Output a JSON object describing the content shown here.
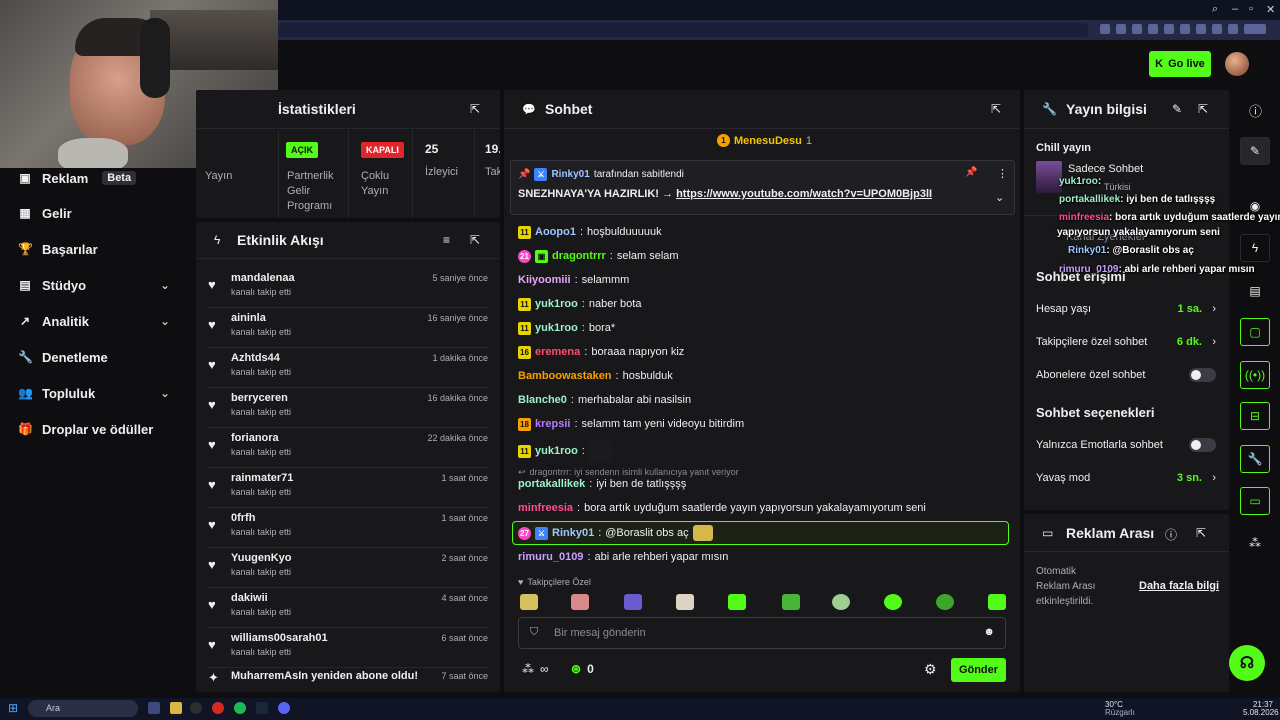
{
  "sidebar": {
    "items": [
      {
        "label": "Reklam",
        "badge": "Beta"
      },
      {
        "label": "Gelir"
      },
      {
        "label": "Başarılar"
      },
      {
        "label": "Stüdyo"
      },
      {
        "label": "Analitik"
      },
      {
        "label": "Denetleme"
      },
      {
        "label": "Topluluk"
      },
      {
        "label": "Droplar ve ödüller"
      }
    ]
  },
  "header": {
    "go_live": "Go live"
  },
  "stats": {
    "title": "İstatistikleri",
    "col1": "Yayın",
    "partner_tag": "AÇIK",
    "partner_label": "Partnerlik Gelir Programı",
    "multi_tag": "KAPALI",
    "multi_label": "Çoklu Yayın",
    "viewers_value": "25",
    "viewers_label": "İzleyici",
    "extra_value": "19.",
    "extra_label": "Tak"
  },
  "activity": {
    "title": "Etkinlik Akışı",
    "events": [
      {
        "name": "mandalenaa",
        "sub": "kanalı takip etti",
        "time": "5 saniye önce"
      },
      {
        "name": "aininla",
        "sub": "kanalı takip etti",
        "time": "16 saniye önce"
      },
      {
        "name": "Azhtds44",
        "sub": "kanalı takip etti",
        "time": "1 dakika önce"
      },
      {
        "name": "berryceren",
        "sub": "kanalı takip etti",
        "time": "16 dakika önce"
      },
      {
        "name": "forianora",
        "sub": "kanalı takip etti",
        "time": "22 dakika önce"
      },
      {
        "name": "rainmater71",
        "sub": "kanalı takip etti",
        "time": "1 saat önce"
      },
      {
        "name": "0frfh",
        "sub": "kanalı takip etti",
        "time": "1 saat önce"
      },
      {
        "name": "YuugenKyo",
        "sub": "kanalı takip etti",
        "time": "2 saat önce"
      },
      {
        "name": "dakiwii",
        "sub": "kanalı takip etti",
        "time": "4 saat önce"
      },
      {
        "name": "williams00sarah01",
        "sub": "kanalı takip etti",
        "time": "6 saat önce"
      }
    ],
    "last": {
      "text": "MuharremAsIn yeniden abone oldu!",
      "time": "7 saat önce"
    }
  },
  "chat": {
    "title": "Sohbet",
    "top_gifter": "MenesuDesu",
    "top_gifter_count": "1",
    "pinned_by": "Rinky01",
    "pinned_by_suffix": "tarafından sabitlendi",
    "pinned_text": "SNEZHNAYA'YA HAZIRLIK! →",
    "pinned_link": "https://www.youtube.com/watch?v=UPOM0Bjp3lI",
    "messages": [
      {
        "badge": "11",
        "badge_type": "y",
        "user": "Aoopo1",
        "color": "#9ec6ff",
        "text": "hoşbulduuuuuk"
      },
      {
        "badge": "21",
        "badge_type": "p",
        "user": "dragontrrr",
        "color": "#53fc18",
        "text": "selam selam"
      },
      {
        "badge": "",
        "badge_type": "",
        "user": "Kiiyoomiii",
        "color": "#e6a7ff",
        "text": "selammm"
      },
      {
        "badge": "11",
        "badge_type": "y",
        "user": "yuk1roo",
        "color": "#9ef0c8",
        "text": "naber bota"
      },
      {
        "badge": "11",
        "badge_type": "y",
        "user": "yuk1roo",
        "color": "#9ef0c8",
        "text": "bora*"
      },
      {
        "badge": "16",
        "badge_type": "y",
        "user": "eremena",
        "color": "#ff4d6d",
        "text": "boraaa napıyon kiz"
      },
      {
        "badge": "",
        "badge_type": "",
        "user": "Bamboowastaken",
        "color": "#f8a000",
        "text": "hosbulduk"
      },
      {
        "badge": "",
        "badge_type": "",
        "user": "Blanche0",
        "color": "#9ef0c8",
        "text": "merhabalar abi nasilsin"
      },
      {
        "badge": "18",
        "badge_type": "o",
        "user": "krepsii",
        "color": "#b57bff",
        "text": "selamm tam yeni videoyu bitirdim"
      },
      {
        "badge": "11",
        "badge_type": "y",
        "user": "yuk1roo",
        "color": "#9ef0c8",
        "text": ""
      }
    ],
    "reply_hint": "dragontrrr: iyi sendenn isimli kullanıcıya yanıt veriyor",
    "msg_portakal": {
      "user": "portakallikek",
      "text": "iyi ben de tatlışşşş"
    },
    "msg_minfree": {
      "user": "minfreesia",
      "text": "bora artık uyduğum saatlerde yayın yapıyorsun yakalayamıyorum seni"
    },
    "msg_rinky": {
      "badge": "27",
      "user": "Rinky01",
      "text": "@Boraslit obs aç"
    },
    "msg_rimuru": {
      "user": "rimuru_0109",
      "text": "abi arle rehberi yapar mısın"
    },
    "followers_only": "Takipçilere Özel",
    "input_placeholder": "Bir mesaj gönderin",
    "points": "∞",
    "kick_points": "0",
    "send": "Gönder"
  },
  "stream_info": {
    "title": "Yayın bilgisi",
    "stream_title": "Chill yayın",
    "category": "Sadece Sohbet",
    "category_lang": "Türkisi"
  },
  "chat_settings": {
    "header_partial": "Kanal Zyenekler",
    "access_title": "Sohbet erişimi",
    "rows": [
      {
        "label": "Hesap yaşı",
        "value": "1 sa."
      },
      {
        "label": "Takipçilere özel sohbet",
        "value": "6 dk."
      },
      {
        "label": "Abonelere özel sohbet",
        "value": ""
      }
    ],
    "options_title": "Sohbet seçenekleri",
    "rows2": [
      {
        "label": "Yalnızca Emotlarla sohbet",
        "value": ""
      },
      {
        "label": "Yavaş mod",
        "value": "3 sn."
      }
    ]
  },
  "ad_break": {
    "title": "Reklam Arası",
    "text": "Otomatik Reklam Arası etkinleştirildi.",
    "link": "Daha fazla bilgi"
  },
  "overlay": [
    {
      "user": "yuk1roo",
      "text": ":",
      "color": "#9ef0c8"
    },
    {
      "user": "portakallikek",
      "text": ": iyi ben de tatlışşşş",
      "color": "#9ef0c8"
    },
    {
      "user": "minfreesia",
      "text": ": bora artık uyduğum saatlerde yayın",
      "color": "#ff4d8d"
    },
    {
      "user": "",
      "text": "yapıyorsun yakalayamıyorum seni",
      "color": "#ffffff"
    },
    {
      "user": "Rinky01",
      "text": ": @Boraslit obs aç",
      "color": "#9ec6ff"
    },
    {
      "user": "rimuru_0109",
      "text": ": abi arle rehberi yapar mısın",
      "color": "#c9a0ff"
    }
  ],
  "taskbar": {
    "search": "Ara",
    "weather_temp": "30°C",
    "weather_desc": "Rüzgarlı",
    "time": "21:37",
    "date": "5.08.2026"
  },
  "colors": {
    "accent": "#53fc18",
    "panel": "#18181b",
    "bg": "#0e0e10"
  }
}
